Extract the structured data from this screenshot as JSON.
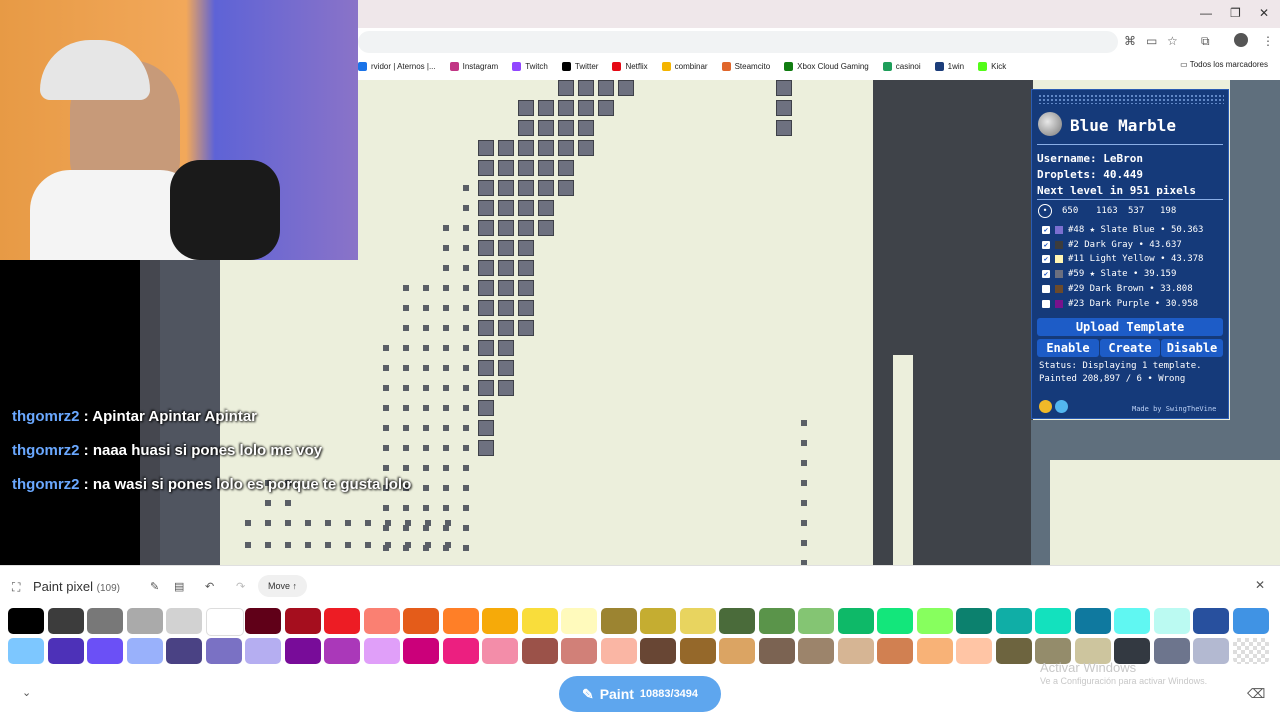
{
  "browser": {
    "bookmarks": [
      {
        "label": "rvidor | Aternos |...",
        "color": "#1a73e8"
      },
      {
        "label": "Instagram",
        "color": "#c13584"
      },
      {
        "label": "Twitch",
        "color": "#9146ff"
      },
      {
        "label": "Twitter",
        "color": "#000000"
      },
      {
        "label": "Netflix",
        "color": "#e50914"
      },
      {
        "label": "combinar",
        "color": "#f4b400"
      },
      {
        "label": "Steamcito",
        "color": "#e0662b"
      },
      {
        "label": "Xbox Cloud Gaming",
        "color": "#107c10"
      },
      {
        "label": "casinoi",
        "color": "#1e9e5a"
      },
      {
        "label": "1win",
        "color": "#1c3d7a"
      },
      {
        "label": "Kick",
        "color": "#53fc18"
      }
    ],
    "all_bookmarks": "Todos los marcadores"
  },
  "chat": [
    {
      "user": "thgomrz2",
      "text": ": Apintar Apintar Apintar"
    },
    {
      "user": "thgomrz2",
      "text": ": naaa huasi si pones lolo me voy"
    },
    {
      "user": "thgomrz2",
      "text": ": na wasi si pones lolo es porque te gusta lolo"
    }
  ],
  "overlay": {
    "title": "Blue Marble",
    "username_label": "Username:",
    "username": "LeBron",
    "droplets_label": "Droplets:",
    "droplets": "40.449",
    "next_level_prefix": "Next level in",
    "next_level_value": "951",
    "next_level_suffix": "pixels",
    "coords": [
      "650",
      "1163",
      "537",
      "198"
    ],
    "colors": [
      {
        "label": "#48 ★ Slate Blue • 50.363",
        "swatch": "#7b6fd0",
        "checked": true
      },
      {
        "label": "#2 Dark Gray • 43.637",
        "swatch": "#3c3c3c",
        "checked": true
      },
      {
        "label": "#11 Light Yellow • 43.378",
        "swatch": "#fff5b3",
        "checked": true
      },
      {
        "label": "#59 ★ Slate • 39.159",
        "swatch": "#6b6f7f",
        "checked": true
      },
      {
        "label": "#29 Dark Brown • 33.808",
        "swatch": "#6b4a2b",
        "checked": false
      },
      {
        "label": "#23 Dark Purple • 30.958",
        "swatch": "#78128c",
        "checked": false
      }
    ],
    "upload": "Upload Template",
    "enable": "Enable",
    "create": "Create",
    "disable": "Disable",
    "status": "Status: Displaying 1 template.",
    "status2": "Painted 208,897 / 6 • Wrong",
    "made_by": "Made by SwingTheVine"
  },
  "toolbar": {
    "paint_pixel": "Paint pixel",
    "count": "(109)",
    "move": "Move",
    "paint_button": "Paint",
    "paint_count": "10883/3494"
  },
  "palette_row1": [
    "#000000",
    "#3c3c3c",
    "#787878",
    "#aaaaaa",
    "#d2d2d2",
    "#ffffff",
    "#600018",
    "#a50e1e",
    "#ed1c24",
    "#fa8072",
    "#e45c1a",
    "#ff7f27",
    "#f6aa09",
    "#f9dd3b",
    "#fffabc",
    "#9c8431",
    "#c5ad31",
    "#e8d45f",
    "#4a6b3a",
    "#5a944a",
    "#84c573",
    "#0eb968",
    "#13e67b",
    "#87ff5e",
    "#0c816e",
    "#10aea6",
    "#13e1be",
    "#0f799f",
    "#60f7f2",
    "#bbfaf2",
    "#28509e",
    "#4093e4"
  ],
  "palette_row2": [
    "#7dc7ff",
    "#4d31b8",
    "#6b50f6",
    "#99b1fb",
    "#4a4284",
    "#7a71c4",
    "#b5aef1",
    "#780c99",
    "#aa38b9",
    "#e09ff9",
    "#cb007a",
    "#ec1f80",
    "#f38da9",
    "#9b5249",
    "#d18078",
    "#fab6a4",
    "#684634",
    "#95682a",
    "#dba463",
    "#7b6352",
    "#9c846b",
    "#d6b594",
    "#d18051",
    "#f8b277",
    "#ffc5a5",
    "#6d643f",
    "#948c6b",
    "#cdc59e",
    "#333941",
    "#6d758d",
    "#b3b9d1",
    "transparent"
  ],
  "windows": {
    "activate": "Activar Windows",
    "goto": "Ve a Configuración para activar Windows."
  }
}
